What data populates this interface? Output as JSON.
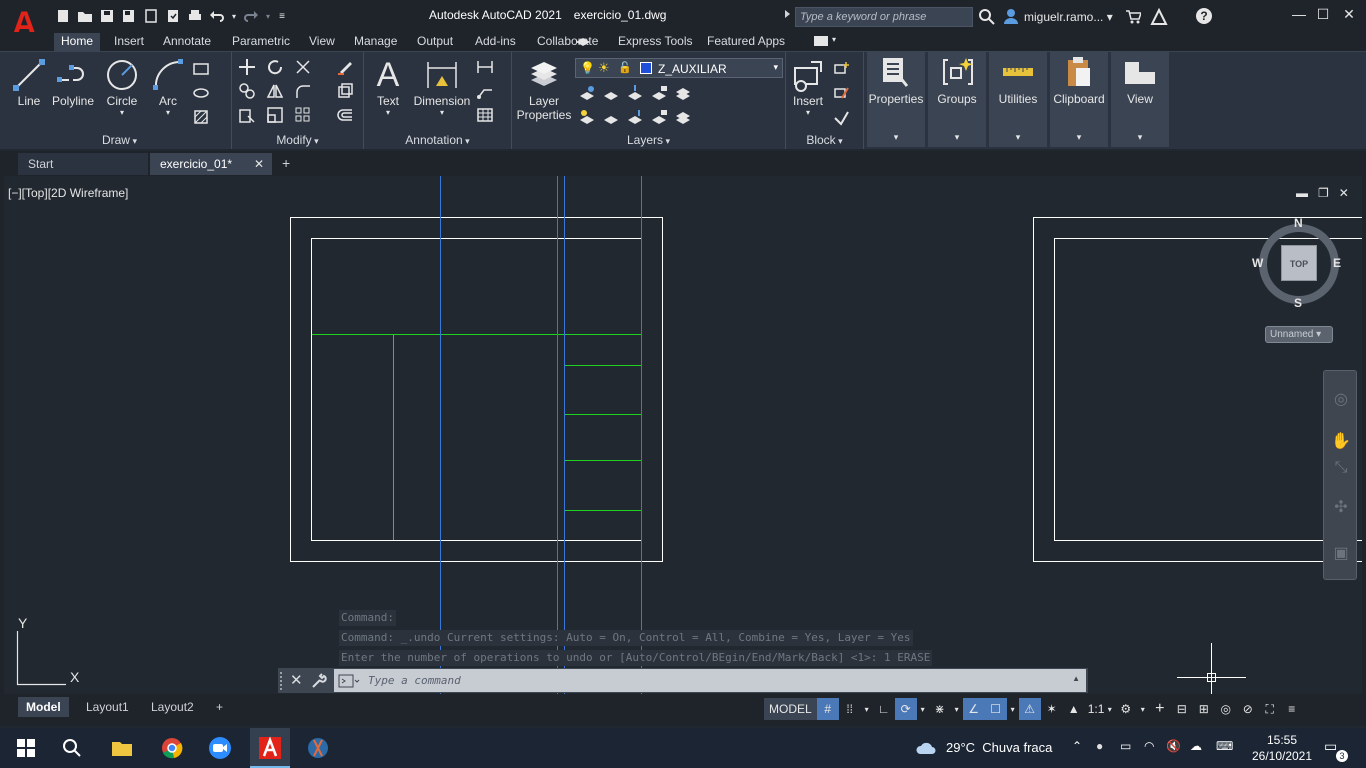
{
  "titlebar": {
    "app": "Autodesk AutoCAD 2021",
    "file": "exercicio_01.dwg",
    "search_placeholder": "Type a keyword or phrase",
    "user": "miguelr.ramo...",
    "logo_letter": "A"
  },
  "ribbon": {
    "tabs": [
      "Home",
      "Insert",
      "Annotate",
      "Parametric",
      "View",
      "Manage",
      "Output",
      "Add-ins",
      "Collaborate",
      "Express Tools",
      "Featured Apps"
    ],
    "active_tab": "Home",
    "draw": {
      "title": "Draw",
      "line": "Line",
      "polyline": "Polyline",
      "circle": "Circle",
      "arc": "Arc"
    },
    "modify": {
      "title": "Modify"
    },
    "annotation": {
      "title": "Annotation",
      "text": "Text",
      "dimension": "Dimension"
    },
    "layers": {
      "title": "Layers",
      "layer_properties_1": "Layer",
      "layer_properties_2": "Properties",
      "current_layer": "Z_AUXILIAR",
      "current_layer_color": "#1f4ed8"
    },
    "block": {
      "title": "Block",
      "insert": "Insert"
    },
    "collapsed": {
      "properties": "Properties",
      "groups": "Groups",
      "utilities": "Utilities",
      "clipboard": "Clipboard",
      "view": "View"
    }
  },
  "file_tabs": {
    "start": "Start",
    "drawing": "exercicio_01*"
  },
  "viewport": {
    "label": "[−][Top][2D Wireframe]",
    "viewcube_face": "TOP",
    "compass": {
      "n": "N",
      "s": "S",
      "e": "E",
      "w": "W"
    },
    "wcs": "Unnamed"
  },
  "command": {
    "history": [
      "Command:",
      "Command: _.undo Current settings: Auto = On, Control = All, Combine = Yes, Layer = Yes",
      "Enter the number of operations to undo or [Auto/Control/BEgin/End/Mark/Back] <1>: 1 ERASE"
    ],
    "placeholder": "Type a command"
  },
  "layouts": [
    "Model",
    "Layout1",
    "Layout2"
  ],
  "status": {
    "model": "MODEL",
    "scale": "1:1"
  },
  "taskbar": {
    "temperature": "29°C",
    "weather": "Chuva fraca",
    "time": "15:55",
    "date": "26/10/2021",
    "notifications": "3"
  },
  "colors": {
    "background": "#212830",
    "geometry_white": "#ffffff",
    "geometry_green": "#1fd21f",
    "geometry_blue": "#3a78d8"
  }
}
